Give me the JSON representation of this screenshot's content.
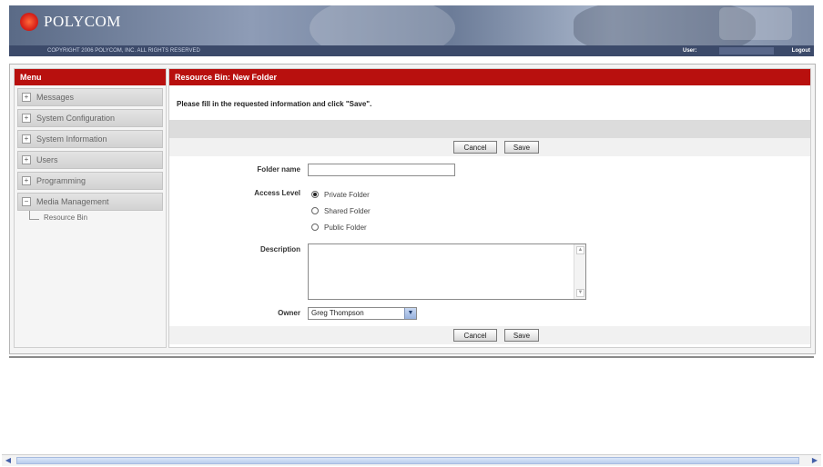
{
  "header": {
    "logo_text": "POLYCOM",
    "copyright": "COPYRIGHT 2006 POLYCOM, INC. ALL RIGHTS RESERVED",
    "user_label": "User:",
    "logout_label": "Logout"
  },
  "menu": {
    "title": "Menu",
    "items": [
      {
        "label": "Messages",
        "expander": "+"
      },
      {
        "label": "System Configuration",
        "expander": "+"
      },
      {
        "label": "System Information",
        "expander": "+"
      },
      {
        "label": "Users",
        "expander": "+"
      },
      {
        "label": "Programming",
        "expander": "+"
      },
      {
        "label": "Media Management",
        "expander": "−"
      }
    ],
    "subitems": [
      {
        "label": "Resource Bin"
      }
    ]
  },
  "content": {
    "title": "Resource Bin: New Folder",
    "instructions": "Please fill in the requested information and click \"Save\".",
    "cancel_label": "Cancel",
    "save_label": "Save",
    "folder_name_label": "Folder name",
    "folder_name_value": "",
    "access_level_label": "Access Level",
    "access_options": [
      {
        "label": "Private Folder",
        "selected": true
      },
      {
        "label": "Shared Folder",
        "selected": false
      },
      {
        "label": "Public Folder",
        "selected": false
      }
    ],
    "description_label": "Description",
    "description_value": "",
    "owner_label": "Owner",
    "owner_value": "Greg Thompson"
  },
  "colors": {
    "accent_red": "#b8100e",
    "header_blue": "#3c4a6a"
  }
}
